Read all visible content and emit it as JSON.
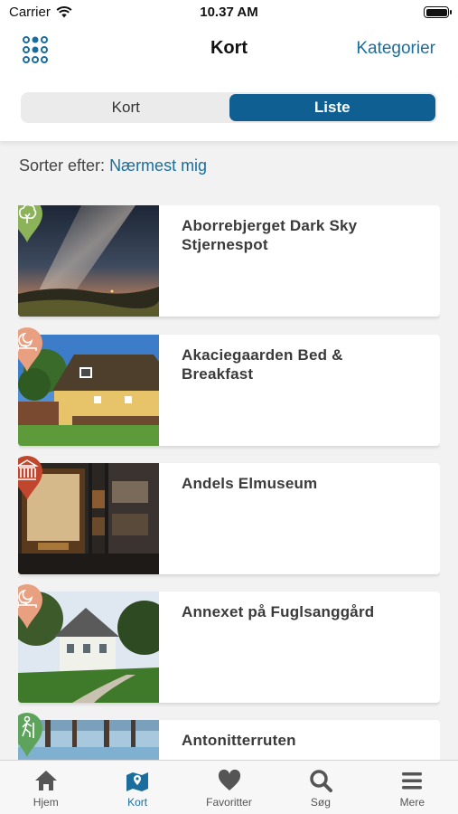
{
  "status": {
    "carrier": "Carrier",
    "time": "10.37 AM"
  },
  "header": {
    "title": "Kort",
    "categories_link": "Kategorier"
  },
  "segments": [
    {
      "label": "Kort",
      "active": false
    },
    {
      "label": "Liste",
      "active": true
    }
  ],
  "sort": {
    "label": "Sorter efter:",
    "value": "Nærmest mig"
  },
  "items": [
    {
      "name": "Aborrebjerget Dark Sky Stjernespot",
      "category_icon": "nature-tree-icon",
      "pin_color": "#8cb35a"
    },
    {
      "name": "Akaciegaarden Bed & Breakfast",
      "category_icon": "sleep-moon-bed-icon",
      "pin_color": "#e8a081"
    },
    {
      "name": "Andels Elmuseum",
      "category_icon": "museum-building-icon",
      "pin_color": "#c0462e"
    },
    {
      "name": "Annexet på Fuglsanggård",
      "category_icon": "sleep-moon-bed-icon",
      "pin_color": "#e8a081"
    },
    {
      "name": "Antonitterruten",
      "category_icon": "hiking-person-icon",
      "pin_color": "#5ea35c"
    }
  ],
  "tabs": [
    {
      "label": "Hjem",
      "icon": "home-icon",
      "active": false
    },
    {
      "label": "Kort",
      "icon": "map-icon",
      "active": true
    },
    {
      "label": "Favoritter",
      "icon": "heart-icon",
      "active": false
    },
    {
      "label": "Søg",
      "icon": "search-icon",
      "active": false
    },
    {
      "label": "Mere",
      "icon": "menu-icon",
      "active": false
    }
  ],
  "colors": {
    "accent": "#1a6d9c",
    "segment_active": "#0f5f92"
  }
}
